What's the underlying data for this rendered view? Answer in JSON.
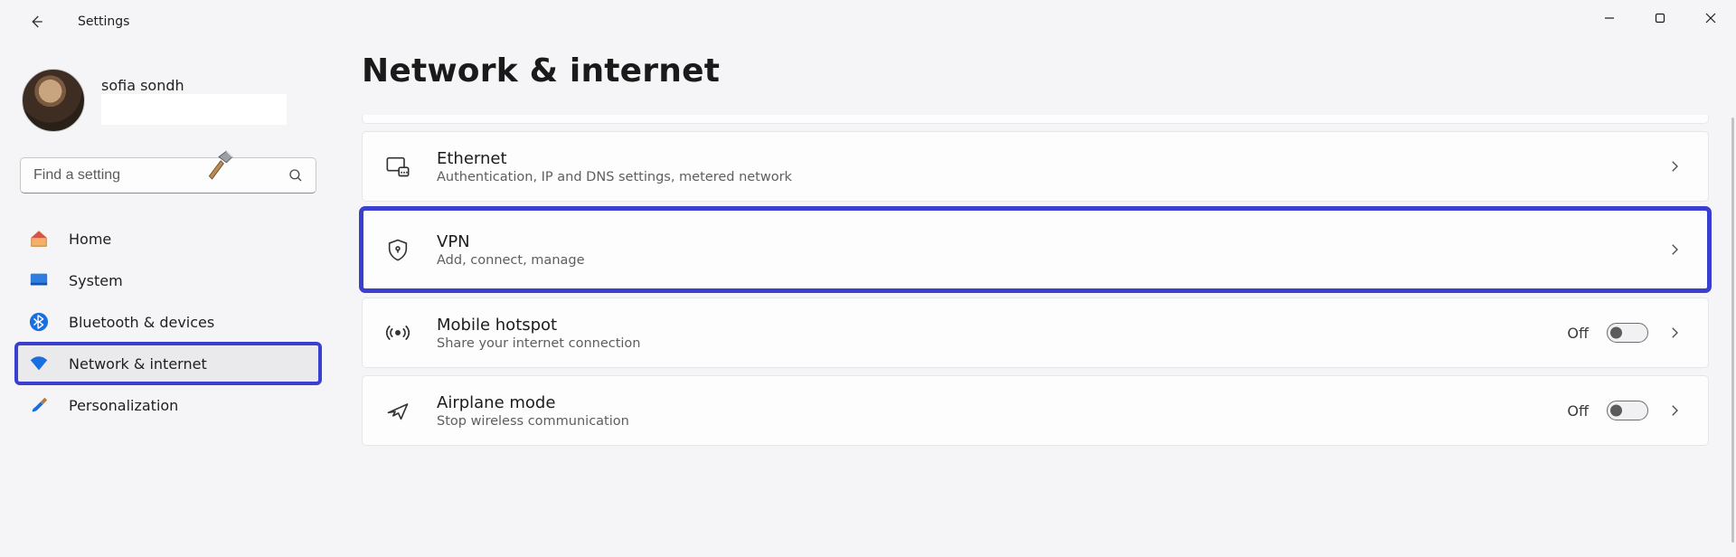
{
  "app": {
    "title": "Settings"
  },
  "account": {
    "name": "sofia sondh"
  },
  "search": {
    "placeholder": "Find a setting"
  },
  "page": {
    "title": "Network & internet"
  },
  "nav": {
    "items": [
      {
        "label": "Home"
      },
      {
        "label": "System"
      },
      {
        "label": "Bluetooth & devices"
      },
      {
        "label": "Network & internet"
      },
      {
        "label": "Personalization"
      }
    ]
  },
  "cards": {
    "ethernet": {
      "label": "Ethernet",
      "sub": "Authentication, IP and DNS settings, metered network"
    },
    "vpn": {
      "label": "VPN",
      "sub": "Add, connect, manage"
    },
    "hotspot": {
      "label": "Mobile hotspot",
      "sub": "Share your internet connection",
      "toggle_text": "Off"
    },
    "airplane": {
      "label": "Airplane mode",
      "sub": "Stop wireless communication",
      "toggle_text": "Off"
    }
  }
}
